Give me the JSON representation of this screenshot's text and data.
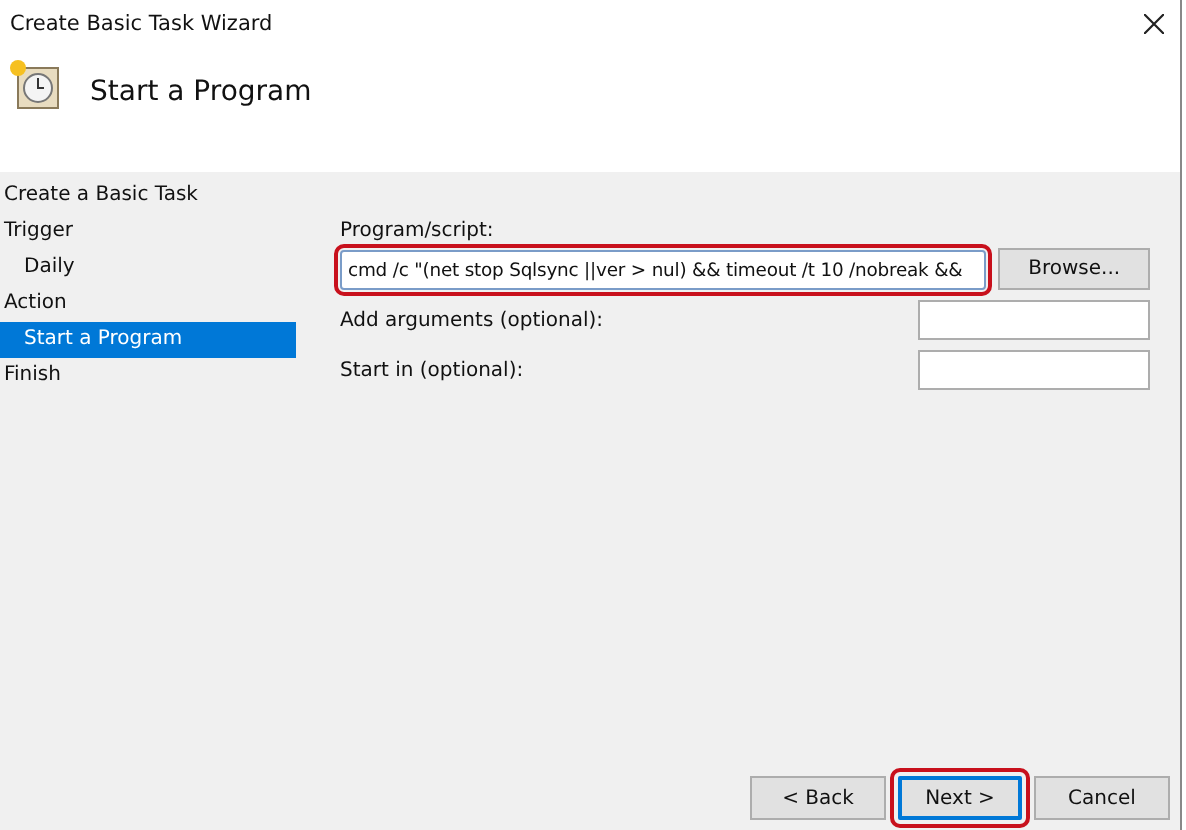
{
  "window": {
    "title": "Create Basic Task Wizard"
  },
  "header": {
    "title": "Start a Program"
  },
  "steps": [
    {
      "label": "Create a Basic Task",
      "selected": false
    },
    {
      "label": "Trigger",
      "children": [
        {
          "label": "Daily",
          "selected": false
        }
      ],
      "selected": false
    },
    {
      "label": "Action",
      "children": [
        {
          "label": "Start a Program",
          "selected": true
        }
      ],
      "selected": false
    },
    {
      "label": "Finish",
      "selected": false
    }
  ],
  "program": {
    "label": "Program/script:",
    "value": "cmd /c \"(net stop Sqlsync ||ver > nul) && timeout /t 10 /nobreak &&",
    "highlighted": true,
    "browse": "Browse..."
  },
  "fields": [
    {
      "label": "Add arguments (optional):"
    },
    {
      "label": "Start in (optional):"
    }
  ],
  "buttons": [
    {
      "label": "< Back",
      "highlighted": false,
      "default": false
    },
    {
      "label": "Next >",
      "highlighted": true,
      "default": true
    },
    {
      "label": "Cancel",
      "highlighted": false,
      "default": false
    }
  ]
}
